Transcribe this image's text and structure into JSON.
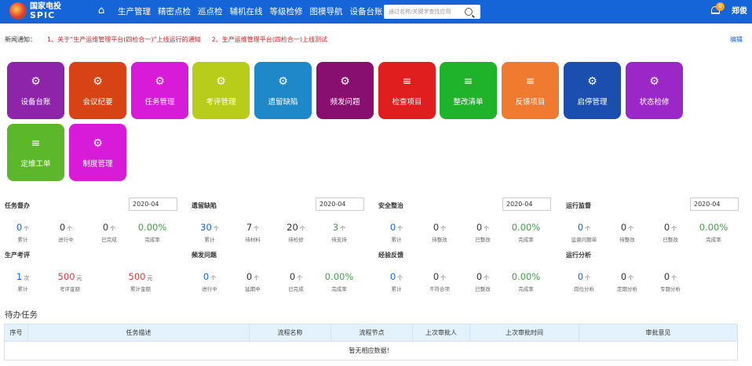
{
  "header": {
    "logo_cn": "国家电投",
    "logo_en": "SPIC",
    "nav": [
      "生产管理",
      "精密点检",
      "巡点检",
      "辅机在线",
      "等级检修",
      "图模导航",
      "设备台账"
    ],
    "search_placeholder": "通过名称/关键字查找应用",
    "notification_count": "0",
    "user": "郑俊"
  },
  "notice": {
    "label": "新闻通知：",
    "items": [
      "1、关于“生产运维管理平台(四检合一)”上线运行的通知",
      "2、生产运维管理平台(四检合一)上线测试"
    ],
    "edit": "编辑"
  },
  "tiles": [
    {
      "label": "设备台账",
      "icon": "gears-icon",
      "color": "#8e24aa"
    },
    {
      "label": "会议纪要",
      "icon": "gear-icon",
      "color": "#d84315"
    },
    {
      "label": "任务管理",
      "icon": "gear-icon",
      "color": "#d81bd8"
    },
    {
      "label": "考评管理",
      "icon": "gear-icon",
      "color": "#b8cc1a"
    },
    {
      "label": "遗留缺陷",
      "icon": "gear-icon",
      "color": "#1e88c8"
    },
    {
      "label": "频发问题",
      "icon": "gears-icon",
      "color": "#880e6f"
    },
    {
      "label": "检查项目",
      "icon": "sliders-icon",
      "color": "#e01e1e"
    },
    {
      "label": "整改清单",
      "icon": "sliders-icon",
      "color": "#1fb32c"
    },
    {
      "label": "反馈项目",
      "icon": "sliders-icon",
      "color": "#f07a30"
    },
    {
      "label": "启停管理",
      "icon": "gear-icon",
      "color": "#1a4fb0"
    },
    {
      "label": "状态检修",
      "icon": "gear-icon",
      "color": "#9c27c9"
    },
    {
      "label": "定维工单",
      "icon": "sliders-icon",
      "color": "#5cb82a"
    },
    {
      "label": "制度管理",
      "icon": "gear-icon",
      "color": "#d81bd8"
    }
  ],
  "stats": [
    {
      "title": "任务督办",
      "date": "2020-04",
      "metrics": [
        {
          "value": "0",
          "unit": "个",
          "label": "累计",
          "color": "blue"
        },
        {
          "value": "0",
          "unit": "个",
          "label": "进行中",
          "color": "dark"
        },
        {
          "value": "0",
          "unit": "个",
          "label": "已完成",
          "color": "dark"
        },
        {
          "value": "0.00%",
          "unit": "",
          "label": "完成率",
          "color": "green"
        }
      ]
    },
    {
      "title": "遗留缺陷",
      "date": "2020-04",
      "metrics": [
        {
          "value": "30",
          "unit": "个",
          "label": "累计",
          "color": "blue"
        },
        {
          "value": "7",
          "unit": "个",
          "label": "待材料",
          "color": "dark"
        },
        {
          "value": "20",
          "unit": "个",
          "label": "待检修",
          "color": "dark"
        },
        {
          "value": "3",
          "unit": "个",
          "label": "待支持",
          "color": "green"
        }
      ]
    },
    {
      "title": "安全整治",
      "date": "2020-04",
      "metrics": [
        {
          "value": "0",
          "unit": "个",
          "label": "累计",
          "color": "blue"
        },
        {
          "value": "0",
          "unit": "个",
          "label": "待整改",
          "color": "dark"
        },
        {
          "value": "0",
          "unit": "个",
          "label": "已整改",
          "color": "dark"
        },
        {
          "value": "0.00%",
          "unit": "",
          "label": "完成率",
          "color": "green"
        }
      ]
    },
    {
      "title": "运行监督",
      "date": "2020-04",
      "metrics": [
        {
          "value": "0",
          "unit": "个",
          "label": "监督问题单",
          "color": "blue"
        },
        {
          "value": "0",
          "unit": "个",
          "label": "待整改",
          "color": "dark"
        },
        {
          "value": "0",
          "unit": "个",
          "label": "已整改",
          "color": "dark"
        },
        {
          "value": "0.00%",
          "unit": "",
          "label": "完成率",
          "color": "green"
        }
      ]
    },
    {
      "title": "生产考评",
      "date": "",
      "metrics": [
        {
          "value": "1",
          "unit": "次",
          "label": "累计",
          "color": "blue"
        },
        {
          "value": "500",
          "unit": "元",
          "label": "考评金额",
          "color": "red"
        },
        {
          "value": "500",
          "unit": "元",
          "label": "累计金额",
          "color": "red"
        }
      ]
    },
    {
      "title": "频发问题",
      "date": "",
      "metrics": [
        {
          "value": "0",
          "unit": "个",
          "label": "进行中",
          "color": "blue"
        },
        {
          "value": "0",
          "unit": "个",
          "label": "延期中",
          "color": "dark"
        },
        {
          "value": "0",
          "unit": "个",
          "label": "已完成",
          "color": "dark"
        },
        {
          "value": "0.00%",
          "unit": "",
          "label": "完成率",
          "color": "green"
        }
      ]
    },
    {
      "title": "经验反馈",
      "date": "",
      "metrics": [
        {
          "value": "0",
          "unit": "个",
          "label": "累计",
          "color": "blue"
        },
        {
          "value": "0",
          "unit": "个",
          "label": "不符合项",
          "color": "dark"
        },
        {
          "value": "0",
          "unit": "个",
          "label": "已整改",
          "color": "dark"
        },
        {
          "value": "0.00%",
          "unit": "",
          "label": "完成率",
          "color": "green"
        }
      ]
    },
    {
      "title": "运行分析",
      "date": "",
      "metrics": [
        {
          "value": "0",
          "unit": "个",
          "label": "岗位分析",
          "color": "blue"
        },
        {
          "value": "0",
          "unit": "个",
          "label": "定期分析",
          "color": "dark"
        },
        {
          "value": "0",
          "unit": "个",
          "label": "专题分析",
          "color": "dark"
        }
      ]
    }
  ],
  "todo": {
    "title": "待办任务",
    "columns": [
      "序号",
      "任务描述",
      "流程名称",
      "流程节点",
      "上次审批人",
      "上次审批时间",
      "审批意见"
    ],
    "empty": "暂无相应数据！"
  }
}
